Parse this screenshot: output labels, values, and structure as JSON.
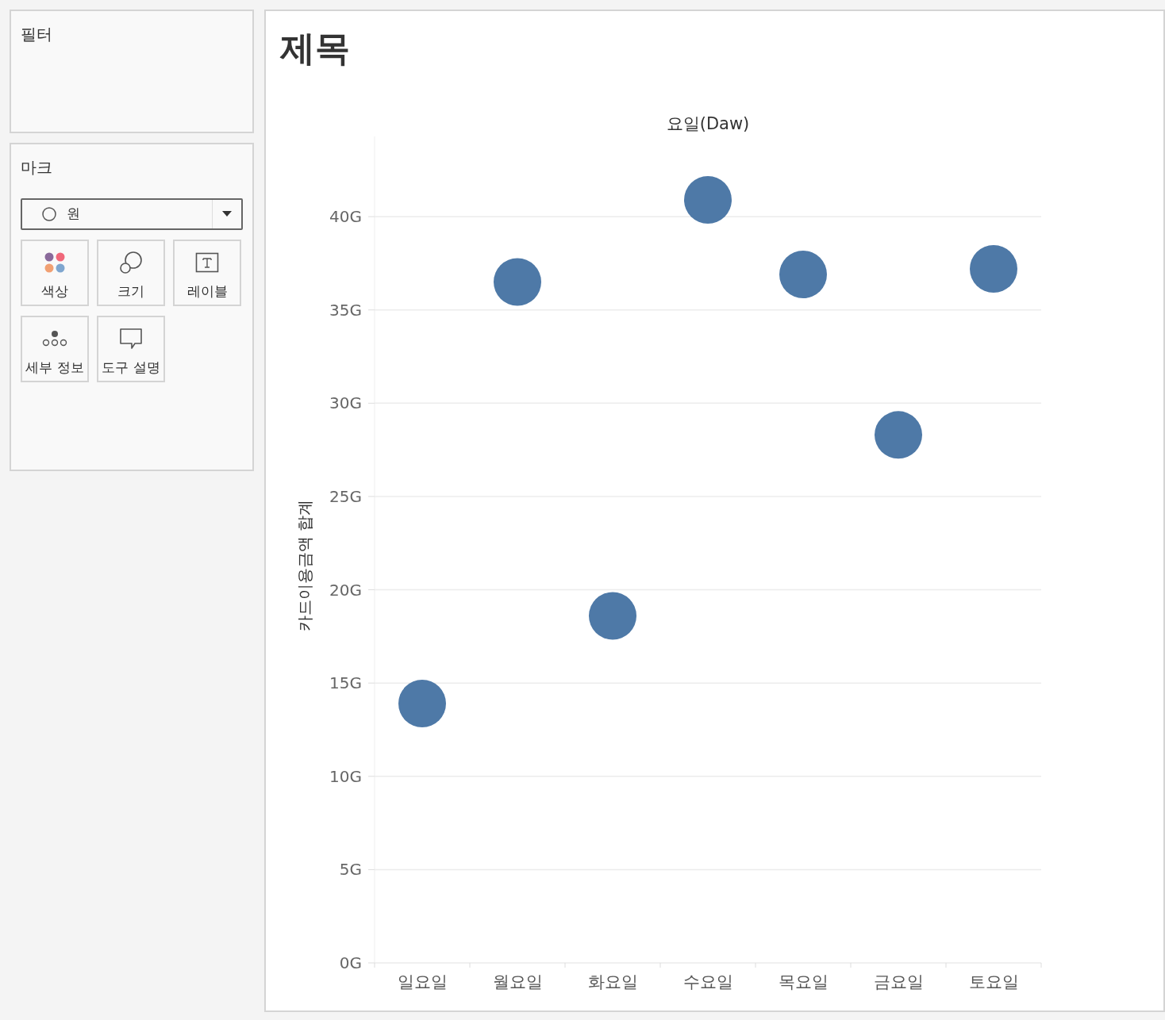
{
  "filters": {
    "title": "필터"
  },
  "marks": {
    "title": "마크",
    "mark_type": "원",
    "buttons": [
      {
        "kind": "color",
        "label": "색상"
      },
      {
        "kind": "size",
        "label": "크기"
      },
      {
        "kind": "label",
        "label": "레이블"
      },
      {
        "kind": "detail",
        "label": "세부 정보"
      },
      {
        "kind": "tooltip",
        "label": "도구 설명"
      }
    ]
  },
  "sheet": {
    "title": "제목",
    "chart_data": {
      "type": "scatter",
      "title": "요일(Daw)",
      "ylabel": "카드이용금액 합계",
      "categories": [
        "일요일",
        "월요일",
        "화요일",
        "수요일",
        "목요일",
        "금요일",
        "토요일"
      ],
      "grid": true,
      "series": [
        {
          "color": "#4e79a7",
          "values": [
            13.9,
            36.5,
            18.6,
            40.9,
            36.9,
            28.3,
            37.2
          ]
        }
      ],
      "ylim": [
        0,
        44.3
      ],
      "yticks": [
        {
          "value": 0,
          "label": "0G"
        },
        {
          "value": 5,
          "label": "5G"
        },
        {
          "value": 10,
          "label": "10G"
        },
        {
          "value": 15,
          "label": "15G"
        },
        {
          "value": 20,
          "label": "20G"
        },
        {
          "value": 25,
          "label": "25G"
        },
        {
          "value": 30,
          "label": "30G"
        },
        {
          "value": 35,
          "label": "35G"
        },
        {
          "value": 40,
          "label": "40G"
        }
      ]
    }
  }
}
